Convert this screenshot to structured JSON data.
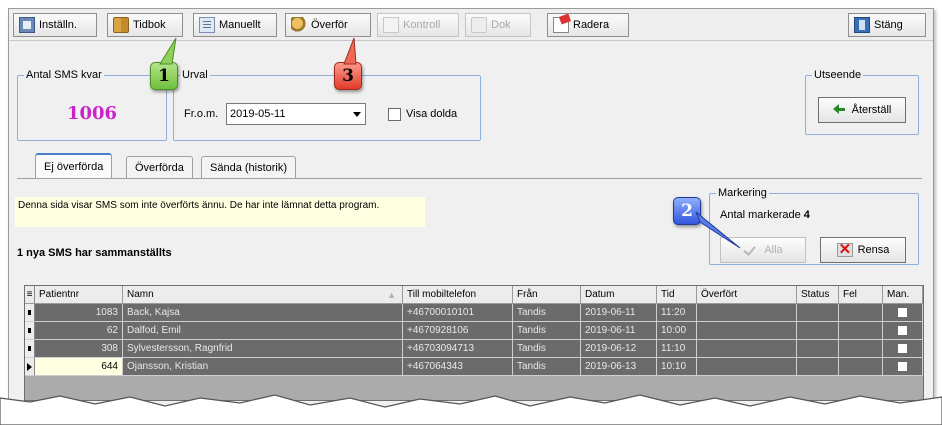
{
  "toolbar": {
    "settings": "Inställn.",
    "phonebook": "Tidbok",
    "manual": "Manuellt",
    "transfer": "Överför",
    "control": "Kontroll",
    "print": "Dok",
    "delete": "Radera",
    "close": "Stäng"
  },
  "sms_count": {
    "legend": "Antal SMS kvar",
    "value": "1006"
  },
  "selection": {
    "legend": "Urval",
    "from_label": "Fr.o.m.",
    "date": "2019-05-11",
    "show_hidden": "Visa dolda"
  },
  "appearance": {
    "legend": "Utseende",
    "reset": "Återställ"
  },
  "tabs": [
    "Ej överförda",
    "Överförda",
    "Sända (historik)"
  ],
  "info_text": "Denna sida visar SMS som inte överförts ännu. De har inte lämnat detta program.",
  "status_text": "1 nya SMS har sammanställts",
  "marking": {
    "legend": "Markering",
    "count_label": "Antal markerade",
    "count": "4",
    "all": "Alla",
    "clear": "Rensa"
  },
  "grid": {
    "headers": [
      "Patientnr",
      "Namn",
      "Till mobiltelefon",
      "Från",
      "Datum",
      "Tid",
      "Överfört",
      "Status",
      "Fel",
      "Man."
    ],
    "rows": [
      [
        "1083",
        "Back, Kajsa",
        "+46700010101",
        "Tandis",
        "2019-06-11",
        "11:20",
        "",
        "",
        ""
      ],
      [
        "62",
        "Dalfod, Emil",
        "+46709281​06",
        "Tandis",
        "2019-06-11",
        "10:00",
        "",
        "",
        ""
      ],
      [
        "308",
        "Sylvestersson, Ragnfrid",
        "+46703094713",
        "Tandis",
        "2019-06-12",
        "11:10",
        "",
        "",
        ""
      ],
      [
        "644",
        "Ojansson, Kristian",
        "+467064343",
        "Tandis",
        "2019-06-13",
        "10:10",
        "",
        "",
        ""
      ]
    ]
  },
  "callouts": [
    "1",
    "2",
    "3"
  ]
}
